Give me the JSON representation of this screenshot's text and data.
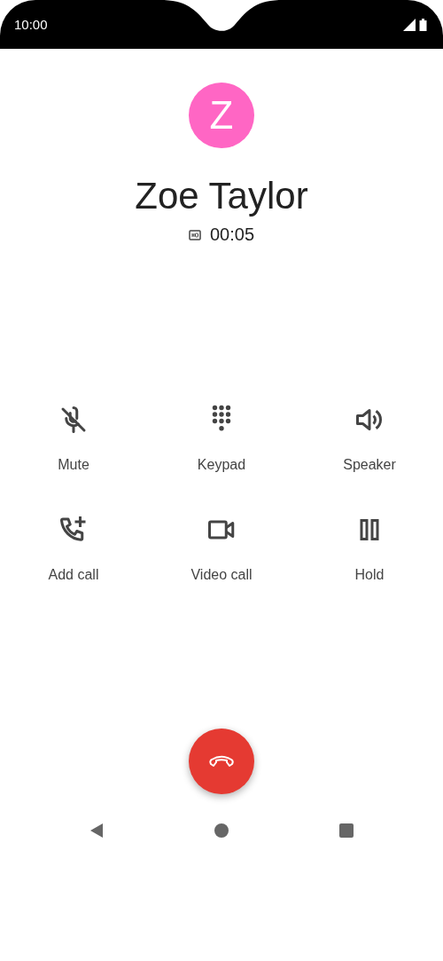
{
  "status_bar": {
    "time": "10:00"
  },
  "contact": {
    "initial": "Z",
    "name": "Zoe Taylor",
    "duration": "00:05"
  },
  "controls": [
    {
      "kind": "mute",
      "label": "Mute"
    },
    {
      "kind": "keypad",
      "label": "Keypad"
    },
    {
      "kind": "speaker",
      "label": "Speaker"
    },
    {
      "kind": "add_call",
      "label": "Add call"
    },
    {
      "kind": "video",
      "label": "Video call"
    },
    {
      "kind": "hold",
      "label": "Hold"
    }
  ]
}
